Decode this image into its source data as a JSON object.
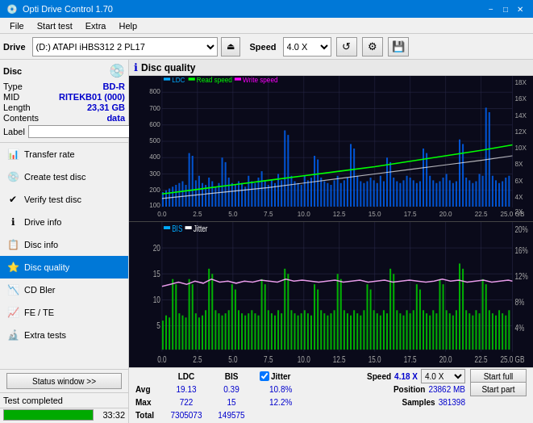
{
  "app": {
    "title": "Opti Drive Control 1.70",
    "title_icon": "💿"
  },
  "title_controls": {
    "minimize": "−",
    "maximize": "□",
    "close": "✕"
  },
  "menu": {
    "items": [
      "File",
      "Start test",
      "Extra",
      "Help"
    ]
  },
  "drive_toolbar": {
    "label": "Drive",
    "drive_value": "(D:)  ATAPI iHBS312  2 PL17",
    "speed_label": "Speed",
    "speed_value": "4.0 X",
    "eject_icon": "⏏"
  },
  "disc": {
    "title": "Disc",
    "type_label": "Type",
    "type_value": "BD-R",
    "mid_label": "MID",
    "mid_value": "RITEKB01 (000)",
    "length_label": "Length",
    "length_value": "23,31 GB",
    "contents_label": "Contents",
    "contents_value": "data",
    "label_label": "Label",
    "label_value": ""
  },
  "nav": {
    "items": [
      {
        "id": "transfer-rate",
        "label": "Transfer rate",
        "icon": "📊"
      },
      {
        "id": "create-test-disc",
        "label": "Create test disc",
        "icon": "💿"
      },
      {
        "id": "verify-test-disc",
        "label": "Verify test disc",
        "icon": "✔"
      },
      {
        "id": "drive-info",
        "label": "Drive info",
        "icon": "ℹ"
      },
      {
        "id": "disc-info",
        "label": "Disc info",
        "icon": "📋"
      },
      {
        "id": "disc-quality",
        "label": "Disc quality",
        "icon": "⭐",
        "active": true
      },
      {
        "id": "cd-bler",
        "label": "CD Bler",
        "icon": "📉"
      },
      {
        "id": "fe-te",
        "label": "FE / TE",
        "icon": "📈"
      },
      {
        "id": "extra-tests",
        "label": "Extra tests",
        "icon": "🔬"
      }
    ]
  },
  "status_window_btn": "Status window >>",
  "progress": {
    "percent": 100,
    "time": "33:32",
    "status": "Test completed"
  },
  "chart": {
    "title": "Disc quality",
    "legend_top": [
      "LDC",
      "Read speed",
      "Write speed"
    ],
    "legend_bottom": [
      "BIS",
      "Jitter"
    ],
    "y_axis_top_left": [
      800,
      700,
      600,
      500,
      400,
      300,
      200,
      100
    ],
    "y_axis_top_right": [
      "18X",
      "16X",
      "14X",
      "12X",
      "10X",
      "8X",
      "6X",
      "4X",
      "2X"
    ],
    "y_axis_bottom_left": [
      20,
      15,
      10,
      5
    ],
    "y_axis_bottom_right": [
      "20%",
      "16%",
      "12%",
      "8%",
      "4%"
    ],
    "x_axis": [
      0.0,
      2.5,
      5.0,
      7.5,
      10.0,
      12.5,
      15.0,
      17.5,
      20.0,
      22.5,
      25.0
    ]
  },
  "stats": {
    "ldc_header": "LDC",
    "bis_header": "BIS",
    "jitter_label": "Jitter",
    "speed_label": "Speed",
    "position_label": "Position",
    "samples_label": "Samples",
    "avg_label": "Avg",
    "max_label": "Max",
    "total_label": "Total",
    "ldc_avg": "19.13",
    "ldc_max": "722",
    "ldc_total": "7305073",
    "bis_avg": "0.39",
    "bis_max": "15",
    "bis_total": "149575",
    "jitter_avg": "10.8%",
    "jitter_max": "12.2%",
    "speed_value": "4.18 X",
    "speed_select": "4.0 X",
    "position_value": "23862 MB",
    "samples_value": "381398",
    "start_full": "Start full",
    "start_part": "Start part"
  }
}
